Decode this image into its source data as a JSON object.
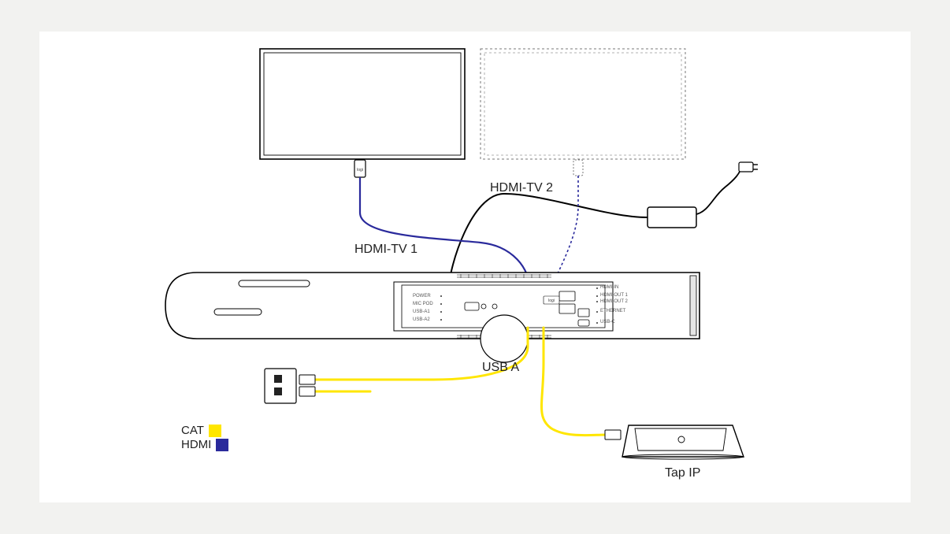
{
  "labels": {
    "hdmi_tv1": "HDMI-TV 1",
    "hdmi_tv2": "HDMI-TV 2",
    "usb_a": "USB A",
    "tap_ip": "Tap IP"
  },
  "legend": {
    "cat_label": "CAT",
    "hdmi_label": "HDMI",
    "cat_color": "#ffe600",
    "hdmi_color": "#2a2a9c"
  },
  "ports": {
    "power": "POWER",
    "mic_pod": "MIC POD",
    "usb_a1": "USB-A1",
    "usb_a2": "USB-A2",
    "hdmi_in": "HDMI-IN",
    "hdmi_out1": "HDMI-OUT 1",
    "hdmi_out2": "HDMI-OUT 2",
    "ethernet": "ETHERNET",
    "usb_c": "USB-C"
  },
  "brand_tag": "logi"
}
